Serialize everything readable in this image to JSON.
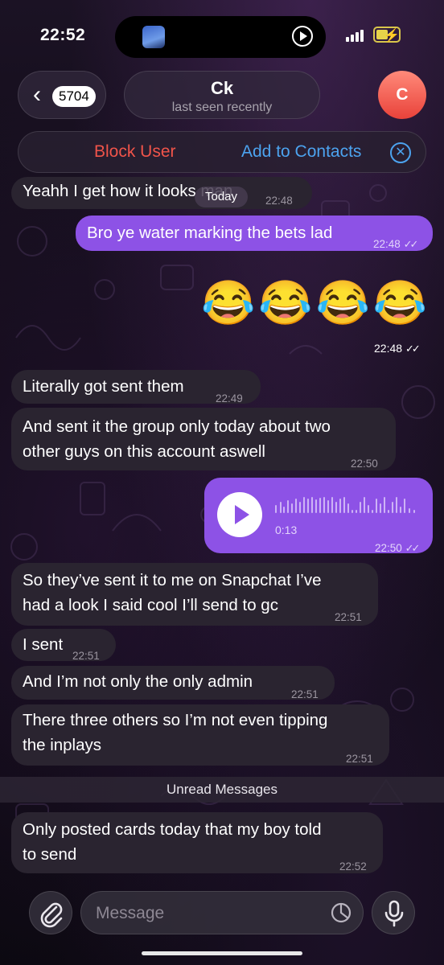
{
  "status": {
    "time": "22:52"
  },
  "header": {
    "back_badge": "5704",
    "contact_name": "Ck",
    "contact_status": "last seen recently",
    "avatar_letter": "C"
  },
  "actions": {
    "block_label": "Block User",
    "add_label": "Add to Contacts"
  },
  "date_chip": "Today",
  "messages": [
    {
      "text": "Yeahh I get how it looks man",
      "time": "22:48",
      "dir": "in"
    },
    {
      "text": "Bro ye water marking the bets lad",
      "time": "22:48",
      "dir": "out"
    },
    {
      "emoji": "😂😂😂😂",
      "time": "22:48",
      "dir": "out"
    },
    {
      "text": "Literally got sent them",
      "time": "22:49",
      "dir": "in"
    },
    {
      "text_line1": "And sent it the group only today about two",
      "text_line2": "other guys on this account aswell",
      "time": "22:50",
      "dir": "in"
    },
    {
      "voice_duration": "0:13",
      "time": "22:50",
      "dir": "out"
    },
    {
      "text_line1": "So they’ve sent it to me on Snapchat I’ve",
      "text_line2": "had a look I said cool I’ll send to gc",
      "time": "22:51",
      "dir": "in"
    },
    {
      "text": "I sent",
      "time": "22:51",
      "dir": "in"
    },
    {
      "text": "And I’m not only the only admin",
      "time": "22:51",
      "dir": "in"
    },
    {
      "text_line1": "There three others so I’m not even tipping",
      "text_line2": "the inplays",
      "time": "22:51",
      "dir": "in"
    },
    {
      "text_line1": "Only posted cards today that my boy told",
      "text_line2": "to send",
      "time": "22:52",
      "dir": "in"
    }
  ],
  "unread_label": "Unread Messages",
  "composer": {
    "placeholder": "Message"
  },
  "colors": {
    "outgoing": "#8d52e6",
    "incoming": "#2a2430",
    "danger": "#f0544a",
    "link": "#4ca3ef"
  }
}
